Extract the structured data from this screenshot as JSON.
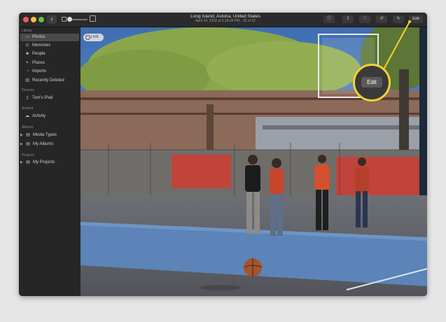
{
  "titlebar": {
    "title": "Long Island, Astoria, United States",
    "subtitle": "April 24, 2018 at 5:18:04 PM  ·  32 of 32",
    "back_glyph": "‹",
    "tools": [
      {
        "name": "info-icon",
        "glyph": "ⓘ"
      },
      {
        "name": "share-icon",
        "glyph": "⇪"
      },
      {
        "name": "heart-icon",
        "glyph": "♡"
      },
      {
        "name": "rotate-icon",
        "glyph": "↺"
      },
      {
        "name": "magic-wand-icon",
        "glyph": "✎"
      }
    ],
    "edit_label": "Edit"
  },
  "sidebar": {
    "library_label": "Library",
    "library_items": [
      {
        "label": "Photos",
        "icon": "▭",
        "selected": true
      },
      {
        "label": "Memories",
        "icon": "◴"
      },
      {
        "label": "People",
        "icon": "☻"
      },
      {
        "label": "Places",
        "icon": "⌖"
      },
      {
        "label": "Imports",
        "icon": "◔"
      },
      {
        "label": "Recently Deleted",
        "icon": "▥"
      }
    ],
    "devices_label": "Devices",
    "device_items": [
      {
        "label": "Tom's iPad",
        "icon": "▯"
      }
    ],
    "shared_label": "Shared",
    "shared_items": [
      {
        "label": "Activity",
        "icon": "☁"
      }
    ],
    "albums_label": "Albums",
    "album_items": [
      {
        "label": "Media Types",
        "icon": "▤"
      },
      {
        "label": "My Albums",
        "icon": "▤"
      }
    ],
    "projects_label": "Projects",
    "project_items": [
      {
        "label": "My Projects",
        "icon": "▤"
      }
    ]
  },
  "photo": {
    "live_label": "LIVE"
  },
  "callout": {
    "label": "Edit",
    "color": "#f2d22e"
  }
}
